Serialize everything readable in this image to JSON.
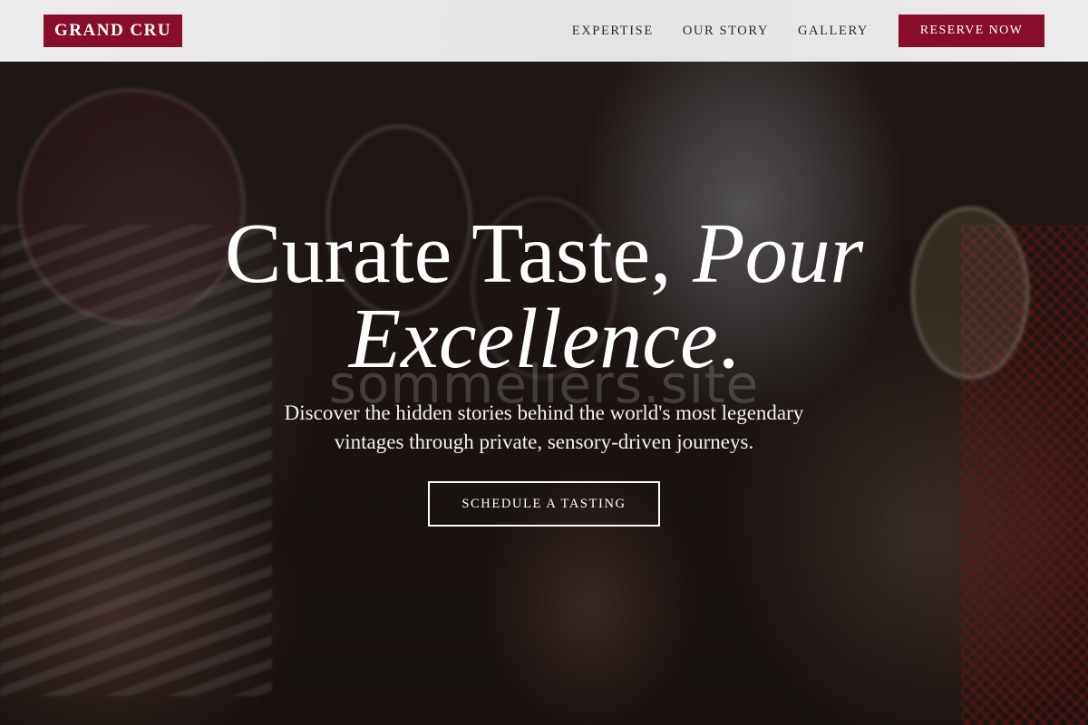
{
  "header": {
    "logo_text": "GRAND CRU",
    "nav": [
      {
        "label": "EXPERTISE"
      },
      {
        "label": "OUR STORY"
      },
      {
        "label": "GALLERY"
      }
    ],
    "cta_label": "RESERVE NOW"
  },
  "hero": {
    "headline_line1_plain": "Curate Taste, ",
    "headline_line1_italic": "Pour",
    "headline_line2_italic": "Excellence",
    "headline_line2_plain": ".",
    "subtext_line1": "Discover the hidden stories behind the world's most legendary",
    "subtext_line2": "vintages through private, sensory-driven journeys.",
    "cta_label": "SCHEDULE A TASTING",
    "watermark": "sommeliers.site",
    "background_image": "people-clinking-wine-glasses-photo"
  },
  "colors": {
    "brand": "#880d2d",
    "header_bg": "#e8e8e8",
    "nav_text": "#2c2c2c",
    "hero_text": "#ffffff"
  }
}
